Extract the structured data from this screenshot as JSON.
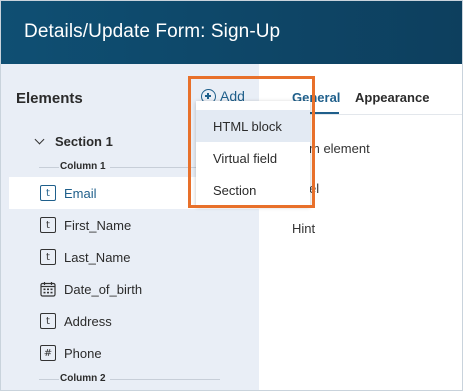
{
  "window": {
    "title": "Details/Update Form: Sign-Up"
  },
  "left_panel": {
    "title": "Elements",
    "add_label": "Add",
    "section_label": "Section 1",
    "column1_label": "Column 1",
    "column2_label": "Column 2",
    "fields": [
      {
        "label": "Email",
        "icon": "text-field-icon",
        "glyph": "t",
        "selected": true
      },
      {
        "label": "First_Name",
        "icon": "text-field-icon",
        "glyph": "t",
        "selected": false
      },
      {
        "label": "Last_Name",
        "icon": "text-field-icon",
        "glyph": "t",
        "selected": false
      },
      {
        "label": "Date_of_birth",
        "icon": "calendar-icon",
        "glyph": "",
        "selected": false
      },
      {
        "label": "Address",
        "icon": "text-field-icon",
        "glyph": "t",
        "selected": false
      },
      {
        "label": "Phone",
        "icon": "number-field-icon",
        "glyph": "#",
        "selected": false
      }
    ]
  },
  "right_panel": {
    "tabs": [
      {
        "label": "General",
        "active": true
      },
      {
        "label": "Appearance",
        "active": false
      }
    ],
    "properties": [
      "m element",
      "el",
      "Hint"
    ]
  },
  "add_menu": {
    "items": [
      "HTML block",
      "Virtual field",
      "Section"
    ],
    "highlighted": "HTML block"
  },
  "colors": {
    "title_bar": "#0f4f73",
    "accent": "#1f5f8b",
    "left_panel_bg": "#e9eef6",
    "highlight_box": "#e8702a"
  }
}
